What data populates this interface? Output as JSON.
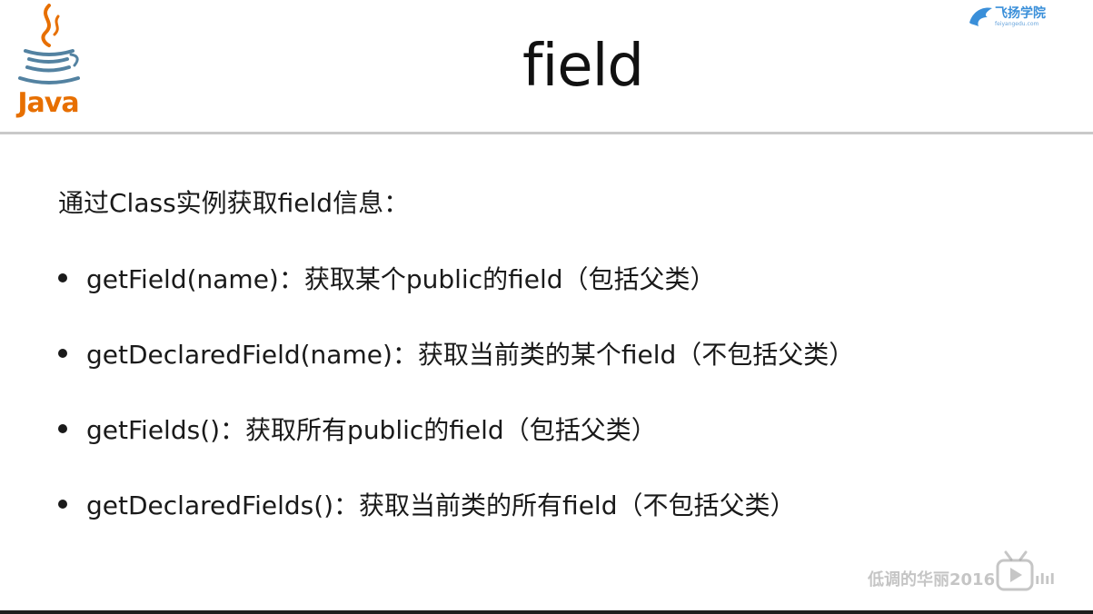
{
  "slide": {
    "title": "field",
    "intro": "通过Class实例获取field信息：",
    "bullets": [
      "getField(name)：获取某个public的field（包括父类）",
      "getDeclaredField(name)：获取当前类的某个field（不包括父类）",
      "getFields()：获取所有public的field（包括父类）",
      "getDeclaredFields()：获取当前类的所有field（不包括父类）"
    ]
  },
  "logos": {
    "java_wordmark": "Java",
    "publisher_name": "飞扬学院",
    "publisher_url": "feiyangedu.com"
  },
  "watermark": {
    "text": "低调的华丽2016",
    "icon": "bilibili-tv-icon"
  },
  "colors": {
    "java_orange": "#e76f00",
    "java_blue": "#5382a1",
    "publisher_blue": "#3a8fd9",
    "title_rule": "#c9c9c9"
  }
}
